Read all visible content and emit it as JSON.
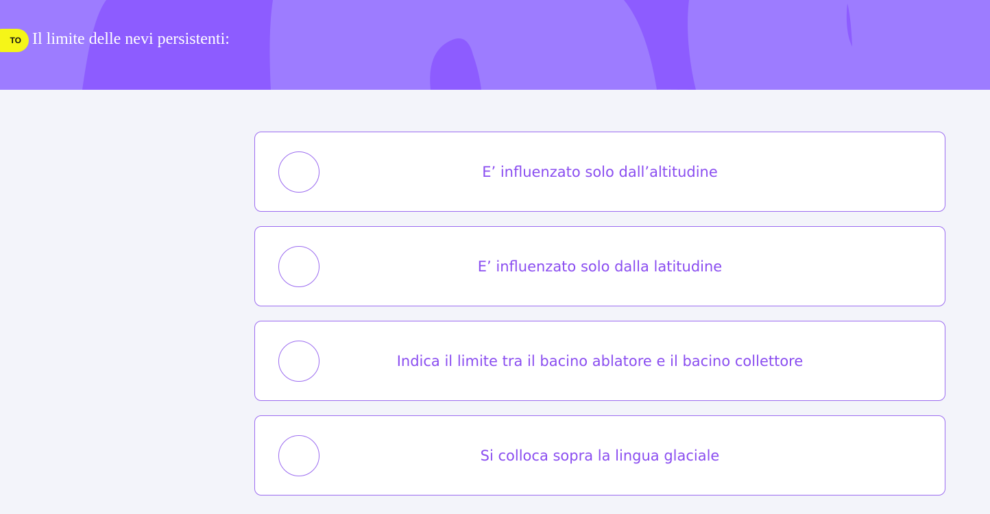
{
  "header": {
    "badge_text": "TO",
    "question": "Il limite delle nevi persistenti:",
    "colors": {
      "background": "#9d7cff",
      "shape": "#8d5cff",
      "badge": "#f5f518"
    }
  },
  "options": [
    {
      "label": "E’ influenzato solo dall’altitudine",
      "selected": false
    },
    {
      "label": "E’ influenzato solo dalla latitudine",
      "selected": false
    },
    {
      "label": "Indica il limite tra il bacino ablatore e il bacino collettore",
      "selected": false
    },
    {
      "label": "Si colloca sopra la lingua glaciale",
      "selected": false
    }
  ],
  "colors": {
    "accent": "#8a4df0",
    "border": "#9b6bf0",
    "page_background": "#f3f4fa"
  }
}
